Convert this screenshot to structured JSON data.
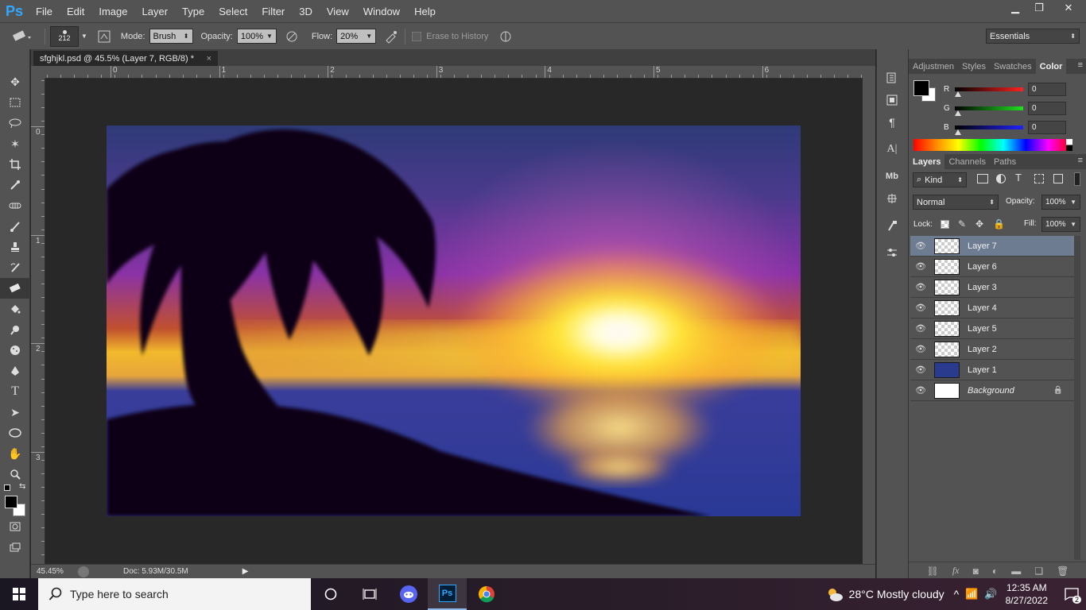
{
  "app": {
    "logo": "Ps"
  },
  "menu": [
    "File",
    "Edit",
    "Image",
    "Layer",
    "Type",
    "Select",
    "Filter",
    "3D",
    "View",
    "Window",
    "Help"
  ],
  "window_controls": {
    "minimize": "▁",
    "restore": "❐",
    "close": "✕"
  },
  "options": {
    "brush_size": "212",
    "mode_label": "Mode:",
    "mode_value": "Brush",
    "opacity_label": "Opacity:",
    "opacity_value": "100%",
    "flow_label": "Flow:",
    "flow_value": "20%",
    "erase_history_label": "Erase to History",
    "erase_history_checked": false,
    "workspace": "Essentials"
  },
  "document": {
    "tab_title": "sfghjkl.psd @ 45.5% (Layer 7, RGB/8) *",
    "tab_close": "×"
  },
  "rulers": {
    "horizontal_numbers": [
      "0",
      "1",
      "2",
      "3",
      "4",
      "5",
      "6"
    ],
    "vertical_numbers": [
      "0",
      "1",
      "2",
      "3"
    ]
  },
  "status": {
    "zoom": "45.45%",
    "doc_info": "Doc: 5.93M/30.5M"
  },
  "color_panel": {
    "tabs": [
      "Adjustmen",
      "Styles",
      "Swatches",
      "Color"
    ],
    "active_tab": "Color",
    "foreground": "#000000",
    "background": "#ffffff",
    "channels": [
      {
        "label": "R",
        "value": "0",
        "color": "#ff2020"
      },
      {
        "label": "G",
        "value": "0",
        "color": "#20e020"
      },
      {
        "label": "B",
        "value": "0",
        "color": "#2020ff"
      }
    ]
  },
  "layers_panel": {
    "tabs": [
      "Layers",
      "Channels",
      "Paths"
    ],
    "active_tab": "Layers",
    "filter_kind": "Kind",
    "blend_mode": "Normal",
    "opacity_label": "Opacity:",
    "opacity_value": "100%",
    "lock_label": "Lock:",
    "fill_label": "Fill:",
    "fill_value": "100%",
    "layers": [
      {
        "name": "Layer 7",
        "selected": true,
        "thumb": "checker",
        "locked": false
      },
      {
        "name": "Layer 6",
        "selected": false,
        "thumb": "checker",
        "locked": false
      },
      {
        "name": "Layer 3",
        "selected": false,
        "thumb": "checker",
        "locked": false
      },
      {
        "name": "Layer 4",
        "selected": false,
        "thumb": "checker",
        "locked": false
      },
      {
        "name": "Layer 5",
        "selected": false,
        "thumb": "checker",
        "locked": false
      },
      {
        "name": "Layer 2",
        "selected": false,
        "thumb": "checker",
        "locked": false
      },
      {
        "name": "Layer 1",
        "selected": false,
        "thumb": "#2a3a8c",
        "locked": false
      },
      {
        "name": "Background",
        "selected": false,
        "thumb": "#ffffff",
        "locked": true
      }
    ]
  },
  "taskbar": {
    "search_placeholder": "Type here to search",
    "weather": "28°C  Mostly cloudy",
    "time": "12:35 AM",
    "date": "8/27/2022",
    "notifications": "2"
  }
}
